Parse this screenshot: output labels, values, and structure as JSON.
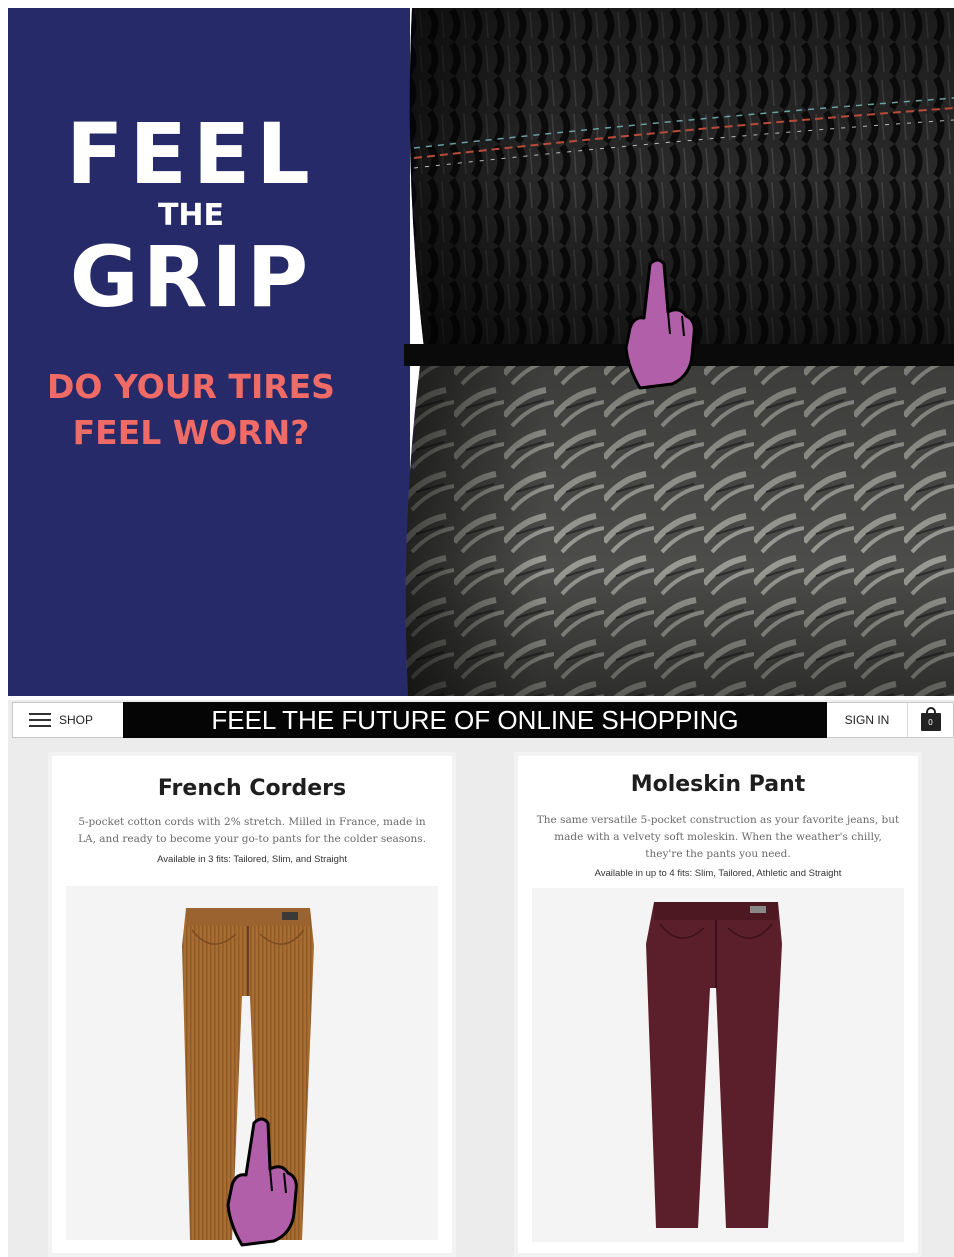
{
  "ad": {
    "headline_line1": "FEEL",
    "headline_line2": "THE",
    "headline_line3": "GRIP",
    "question_line1": "DO YOUR TIRES",
    "question_line2": "FEEL WORN?"
  },
  "shop": {
    "nav": {
      "shop_label": "SHOP",
      "banner": "FEEL THE FUTURE OF ONLINE SHOPPING",
      "signin_label": "SIGN IN",
      "cart_count": "0"
    },
    "products": [
      {
        "title": "French Corders",
        "description": "5-pocket cotton cords with 2% stretch. Milled in France, made in LA, and ready to become your go-to pants for the colder seasons.",
        "fits": "Available in 3 fits: Tailored, Slim, and Straight",
        "color": "#a86d32"
      },
      {
        "title": "Moleskin Pant",
        "description": "The same versatile 5-pocket construction as your favorite jeans, but made with a velvety soft moleskin. When the weather's chilly, they're the pants you need.",
        "fits": "Available in up to 4 fits: Slim, Tailored, Athletic and Straight",
        "color": "#5a1f2a"
      }
    ]
  },
  "colors": {
    "ad_background": "#262a69",
    "headline": "#ffffff",
    "question": "#f06b66",
    "pointer": "#b05fa8",
    "banner_background": "#050505"
  },
  "icons": {
    "pointer": "pointing-finger-icon",
    "menu": "hamburger-icon",
    "cart": "shopping-bag-icon"
  }
}
